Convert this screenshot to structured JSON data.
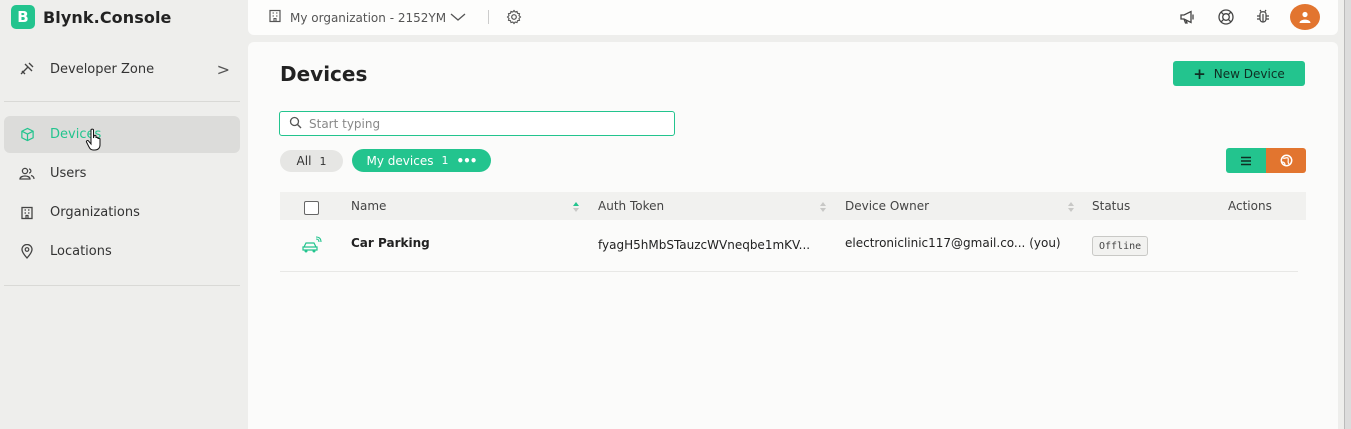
{
  "app": {
    "logo_letter": "B",
    "brand": "Blynk.Console"
  },
  "sidebar": {
    "developer_zone": {
      "label": "Developer Zone",
      "chevron": ">"
    },
    "items": [
      {
        "label": "Devices",
        "icon": "cube-icon",
        "active": true
      },
      {
        "label": "Users",
        "icon": "users-icon",
        "active": false
      },
      {
        "label": "Organizations",
        "icon": "building-icon",
        "active": false
      },
      {
        "label": "Locations",
        "icon": "location-pin-icon",
        "active": false
      }
    ]
  },
  "topbar": {
    "organization": "My organization - 2152YM",
    "icons": [
      "megaphone-icon",
      "help-lifebuoy-icon",
      "bug-icon",
      "user-avatar-icon"
    ]
  },
  "main": {
    "title": "Devices",
    "new_device_label": "New Device",
    "search_placeholder": "Start typing",
    "filters": {
      "all_label": "All",
      "all_count": "1",
      "my_label": "My devices",
      "my_count": "1",
      "my_more": "•••"
    },
    "table": {
      "columns": [
        "Name",
        "Auth Token",
        "Device Owner",
        "Status",
        "Actions"
      ],
      "rows": [
        {
          "name": "Car Parking",
          "auth_token": "fyagH5hMbSTauzcWVneqbe1mKV...",
          "owner": "electroniclinic117@gmail.co... (you)",
          "status": "Offline"
        }
      ]
    }
  },
  "colors": {
    "accent": "#23c48e",
    "orange": "#e2752f",
    "background": "#eeeeec",
    "panel": "#fbfbfa"
  }
}
